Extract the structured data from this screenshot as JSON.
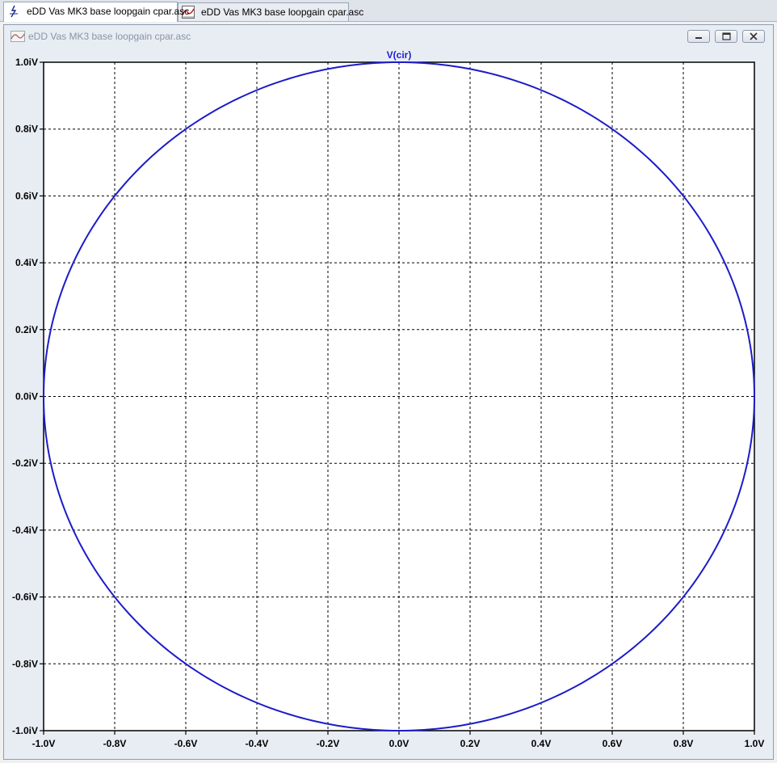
{
  "tabs": [
    {
      "label": "eDD Vas MK3 base loopgain cpar.asc",
      "icon": "schematic-icon",
      "active": true
    },
    {
      "label": "eDD Vas MK3 base loopgain cpar.asc",
      "icon": "waveform-icon",
      "active": false
    }
  ],
  "window": {
    "title": "eDD Vas MK3 base loopgain cpar.asc",
    "icon": "waveform-icon",
    "buttons": [
      "minimize-icon",
      "restore-icon",
      "close-icon"
    ]
  },
  "colors": {
    "trace": "#1c1cc8",
    "trace_label": "#1f1fd0",
    "grid": "#000000",
    "plot_bg": "#ffffff"
  },
  "chart_data": {
    "type": "line",
    "trace_label": "V(cir)",
    "series": [
      {
        "name": "V(cir)",
        "shape": "unit-circle",
        "x_range": [
          -1.0,
          1.0
        ],
        "y_range": [
          -1.0,
          1.0
        ]
      }
    ],
    "xlim": [
      -1.0,
      1.0
    ],
    "ylim": [
      -1.0,
      1.0
    ],
    "xticks": [
      {
        "value": -1.0,
        "label": "-1.0V"
      },
      {
        "value": -0.8,
        "label": "-0.8V"
      },
      {
        "value": -0.6,
        "label": "-0.6V"
      },
      {
        "value": -0.4,
        "label": "-0.4V"
      },
      {
        "value": -0.2,
        "label": "-0.2V"
      },
      {
        "value": 0.0,
        "label": "0.0V"
      },
      {
        "value": 0.2,
        "label": "0.2V"
      },
      {
        "value": 0.4,
        "label": "0.4V"
      },
      {
        "value": 0.6,
        "label": "0.6V"
      },
      {
        "value": 0.8,
        "label": "0.8V"
      },
      {
        "value": 1.0,
        "label": "1.0V"
      }
    ],
    "yticks": [
      {
        "value": 1.0,
        "label": "1.0iV"
      },
      {
        "value": 0.8,
        "label": "0.8iV"
      },
      {
        "value": 0.6,
        "label": "0.6iV"
      },
      {
        "value": 0.4,
        "label": "0.4iV"
      },
      {
        "value": 0.2,
        "label": "0.2iV"
      },
      {
        "value": 0.0,
        "label": "0.0iV"
      },
      {
        "value": -0.2,
        "label": "-0.2iV"
      },
      {
        "value": -0.4,
        "label": "-0.4iV"
      },
      {
        "value": -0.6,
        "label": "-0.6iV"
      },
      {
        "value": -0.8,
        "label": "-0.8iV"
      },
      {
        "value": -1.0,
        "label": "-1.0iV"
      }
    ],
    "grid": true,
    "legend": "top-center"
  }
}
